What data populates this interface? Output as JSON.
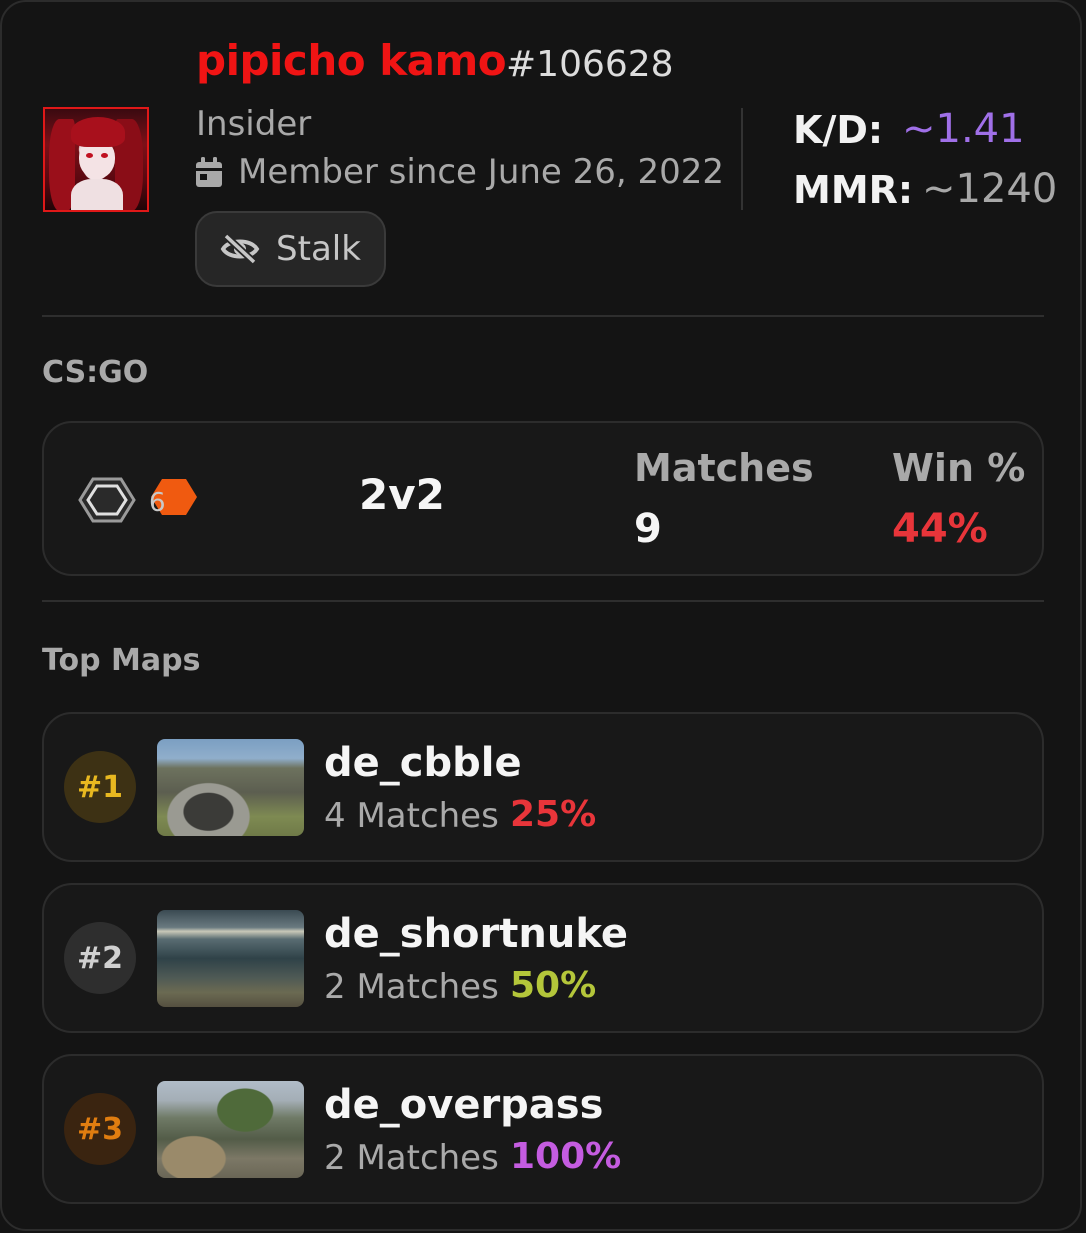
{
  "profile": {
    "username": "pipicho kamo",
    "user_id": "#106628",
    "role": "Insider",
    "member_since": "Member since June 26, 2022",
    "stalk_label": "Stalk",
    "kd_label": "K/D:",
    "kd_value": "~1.41",
    "mmr_label": "MMR:",
    "mmr_value": "~1240"
  },
  "game": {
    "title": "CS:GO",
    "level": "6",
    "mode": "2v2",
    "matches_label": "Matches",
    "matches_value": "9",
    "win_label": "Win %",
    "win_value": "44%"
  },
  "top_maps": {
    "title": "Top Maps",
    "items": [
      {
        "rank": "#1",
        "name": "de_cbble",
        "matches": "4 Matches",
        "pct": "25%"
      },
      {
        "rank": "#2",
        "name": "de_shortnuke",
        "matches": "2 Matches",
        "pct": "50%"
      },
      {
        "rank": "#3",
        "name": "de_overpass",
        "matches": "2 Matches",
        "pct": "100%"
      }
    ]
  },
  "colors": {
    "username": "#f01414",
    "kd": "#a070e8",
    "win_red": "#e8353a",
    "pct_green": "#b4c63a",
    "pct_purple": "#c45ce0",
    "rank1": "#e8b820",
    "rank3": "#e07d10"
  },
  "icons": {
    "calendar": "calendar-icon",
    "stalk": "eye-slash-icon",
    "rank": "hexagon-rank-icon",
    "level": "level-badge-icon"
  }
}
